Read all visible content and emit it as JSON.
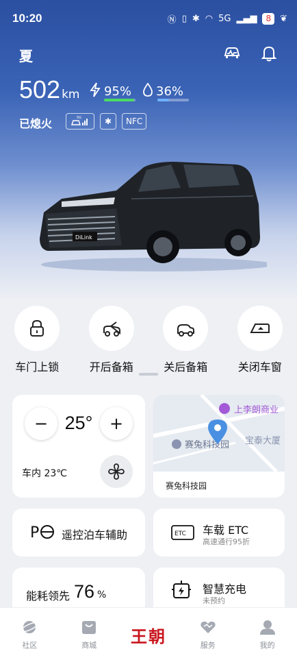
{
  "status_bar": {
    "time": "10:20",
    "network": "5G",
    "battery": "8"
  },
  "header": {
    "season": "夏",
    "range_value": "502",
    "range_unit": "km",
    "battery_percent": "95%",
    "battery_level": 0.95,
    "fuel_percent": "36%",
    "fuel_level": 0.36,
    "engine_state": "已熄火",
    "chip_network": "5G",
    "chip_nfc": "NFC",
    "car_badge": "DiLink"
  },
  "actions": [
    {
      "label": "车门上锁",
      "icon": "lock-icon"
    },
    {
      "label": "开后备箱",
      "icon": "trunk-open-icon"
    },
    {
      "label": "关后备箱",
      "icon": "trunk-close-icon"
    },
    {
      "label": "关闭车窗",
      "icon": "window-close-icon"
    }
  ],
  "climate": {
    "minus": "−",
    "plus": "+",
    "temperature": "25°",
    "inside": "车内 23℃"
  },
  "map": {
    "poi_top": "上李朗商业",
    "poi_mid": "赛兔科技园",
    "poi_right": "宝泰大厦",
    "location": "赛兔科技园"
  },
  "features": {
    "parking": {
      "title": "遥控泊车辅助",
      "icon_text": "P"
    },
    "etc": {
      "title": "车载 ETC",
      "subtitle": "高速通行95折",
      "icon_text": "ETC"
    },
    "energy": {
      "title": "能耗领先",
      "value": "76",
      "unit": "%"
    },
    "charging": {
      "title": "智慧充电",
      "subtitle": "未预约"
    }
  },
  "nav": [
    {
      "label": "社区",
      "icon": "planet-icon"
    },
    {
      "label": "商城",
      "icon": "shop-icon"
    },
    {
      "label": "王朝",
      "icon": "brand-logo"
    },
    {
      "label": "服务",
      "icon": "service-icon"
    },
    {
      "label": "我的",
      "icon": "profile-icon"
    }
  ],
  "colors": {
    "accent": "#c9151e",
    "battery": "#4cd964",
    "fuel": "#6fb1ff",
    "map_pin": "#4a90e2"
  }
}
